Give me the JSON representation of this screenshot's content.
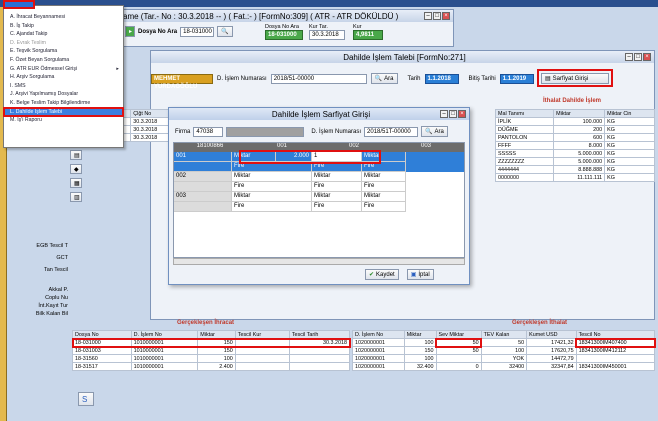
{
  "main_window": {
    "title_prefix": "ame (Tar.- No : 30.3.2018 -- ) ( Fat.:- ) [FormNo:309] ( ATR - ATR DÖKÜLDÜ )",
    "dosya_no_label": "Dosya No Ara",
    "dosya_no_value": "18-031000",
    "kur_tar_label": "Kur Tar.",
    "dosya_no2": "18-031000",
    "kur_tar_value": "30.3.2018",
    "kur_label": "Kur",
    "kur_value": "4,9811"
  },
  "menu": {
    "items": [
      {
        "label": "A. İhracat Beyannamesi",
        "dim": false
      },
      {
        "label": "B. İş Takip",
        "dim": false
      },
      {
        "label": "C. Ajandat Takip",
        "dim": false
      },
      {
        "label": "D. Evrak Teslim",
        "dim": true
      },
      {
        "label": "E. Teşvik Sorgulama",
        "dim": false
      },
      {
        "label": "F. Özet Beyan Sorgulama",
        "dim": false
      },
      {
        "label": "G. ATR EUR Ödmessel Girişi",
        "dim": false,
        "arrow": "▸"
      },
      {
        "label": "H. Arşiv Sorgulama",
        "dim": false
      },
      {
        "label": "I. SMS",
        "dim": false
      },
      {
        "label": "J. Arşivi Yapılmamış Dosyalar",
        "dim": false
      },
      {
        "label": "K. Belge Teslim Takip Bilgilendirme",
        "dim": false
      },
      {
        "label": "L. Dahilde İşlem Talebi",
        "dim": false,
        "selected": true
      },
      {
        "label": "M. İş'i Raporu",
        "dim": false
      }
    ]
  },
  "dahilde_window": {
    "title": "Dahilde İşlem Talebi [FormNo:271]",
    "company": "MEHMET YURDAGÖĞLU",
    "islem_no_label": "D. İşlem Numarası",
    "islem_no_value": "2018/51-00000",
    "ara_label": "Ara",
    "tarih_label": "Tarih",
    "tarih_value": "1.1.2018",
    "bitis_label": "Bitiş Tarihi",
    "bitis_value": "1.1.2019",
    "sarfiyat_btn": "Sarfiyat Girişi",
    "ithalat_title": "İthalat Dahilde İşlem",
    "ithalat_headers": [
      "Mal Tanımı",
      "Miktar",
      "Miktar Cin"
    ],
    "ithalat_rows": [
      [
        "İPLİK",
        "100.000",
        "KG"
      ],
      [
        "DÜĞME",
        "200",
        "KG"
      ],
      [
        "PANTOLON",
        "600",
        "KG"
      ],
      [
        "FFFF",
        "8.000",
        "KG"
      ],
      [
        "SSSSS",
        "5.000.000",
        "KG"
      ],
      [
        "ZZZZZZZZ",
        "5.000.000",
        "KG"
      ],
      [
        "4444444",
        "8.888.888",
        "KG"
      ],
      [
        "0000000",
        "11.111.111",
        "KG"
      ]
    ],
    "left_headers": [
      "",
      "Çlğt No"
    ],
    "left_rows": [
      [
        "",
        "30.3.2018"
      ],
      [
        "",
        "30.3.2018"
      ],
      [
        "",
        "30.3.2018"
      ]
    ]
  },
  "dialog": {
    "title": "Dahilde İşlem Sarfiyat Girişi",
    "firma_label": "Firma",
    "firma_value": "47038",
    "islem_no_label": "D. İşlem Numarası",
    "islem_no_value": "2018/51T-00000",
    "ara_label": "Ara",
    "grid_header": [
      "18100866",
      "001",
      "002",
      "003"
    ],
    "rows": [
      {
        "code": "001",
        "top": [
          "Miktar",
          "2.000",
          "1",
          "Miktar"
        ],
        "bottom": [
          "Fire",
          "Fire",
          "Fire"
        ]
      },
      {
        "code": "002",
        "top": [
          "Miktar",
          "",
          "Miktar",
          "Miktar"
        ],
        "bottom": [
          "Fire",
          "Fire",
          "Fire"
        ]
      },
      {
        "code": "003",
        "top": [
          "Miktar",
          "",
          "Miktar",
          "Miktar"
        ],
        "bottom": [
          "Fire",
          "Fire",
          "Fire"
        ]
      }
    ],
    "kaydet": "Kaydet",
    "iptal": "İptal"
  },
  "side_labels": {
    "ego_tescil": "EGB Tescil T",
    "gct": "GCT",
    "tan_tescil": "Tan Tescil",
    "akkal": "Akkal P.",
    "coplu_num": "Coplu Nu",
    "int_kayit": "İnt.Kayıt Tur",
    "bilk_kalan": "Bilk Kalan Bil"
  },
  "gerceklesen_ihracat": {
    "title": "Gerçekleşen İhracat",
    "headers": [
      "Dosya No",
      "D. İşlem No",
      "Miktar",
      "Tescil Kur",
      "Tescil Tarih"
    ],
    "rows": [
      [
        "18-031000",
        "1010000001",
        "150",
        "",
        "30.3.2018"
      ],
      [
        "18-031003",
        "1010000001",
        "150",
        "",
        ""
      ],
      [
        "18-31560",
        "1010000001",
        "100",
        "",
        ""
      ],
      [
        "18-31517",
        "1010000001",
        "2.400",
        "",
        ""
      ]
    ]
  },
  "gerceklesen_ithalat": {
    "title": "Gerçekleşen İthalat",
    "headers": [
      "D. İşlem No",
      "Miktar",
      "Sev Miktar",
      "TEV Kalan",
      "Kumet USD",
      "Tescil No"
    ],
    "rows": [
      [
        "1020000001",
        "100",
        "50",
        "50",
        "17421,32",
        "18341300IM407400"
      ],
      [
        "1020000001",
        "150",
        "50",
        "100",
        "17620,75",
        "18341300IM412112"
      ],
      [
        "1020000001",
        "100",
        "",
        "YOK",
        "14472,79",
        ""
      ],
      [
        "1020000001",
        "32.400",
        "0",
        "32400",
        "32347,84",
        "18341300IM450001"
      ]
    ]
  }
}
